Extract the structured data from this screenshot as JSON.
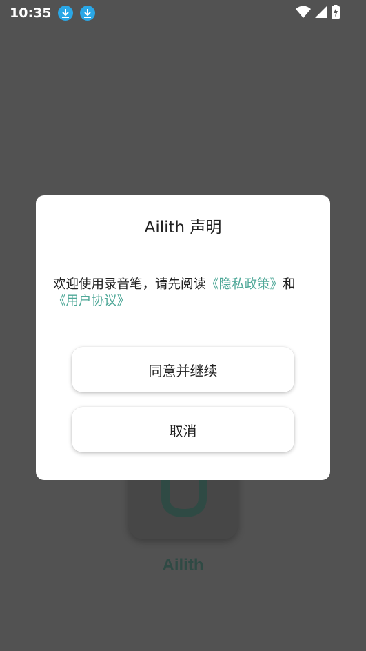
{
  "status_bar": {
    "time": "10:35",
    "download_icons": [
      "download-icon",
      "download-icon"
    ],
    "right_icons": [
      "wifi-icon",
      "cell-signal-icon",
      "battery-charging-icon"
    ]
  },
  "splash": {
    "app_name": "Ailith"
  },
  "dialog": {
    "title": "Ailith 声明",
    "message_prefix": "欢迎使用录音笔，请先阅读",
    "privacy_link": "《隐私政策》",
    "conjunction": "和",
    "agreement_link": "《用户协议》",
    "agree_button": "同意并继续",
    "cancel_button": "取消"
  },
  "colors": {
    "scrim": "#525252",
    "dialog_bg": "#ffffff",
    "link": "#4fa898",
    "download_badge": "#2aa7e6",
    "logo_accent": "#2f4a44"
  }
}
